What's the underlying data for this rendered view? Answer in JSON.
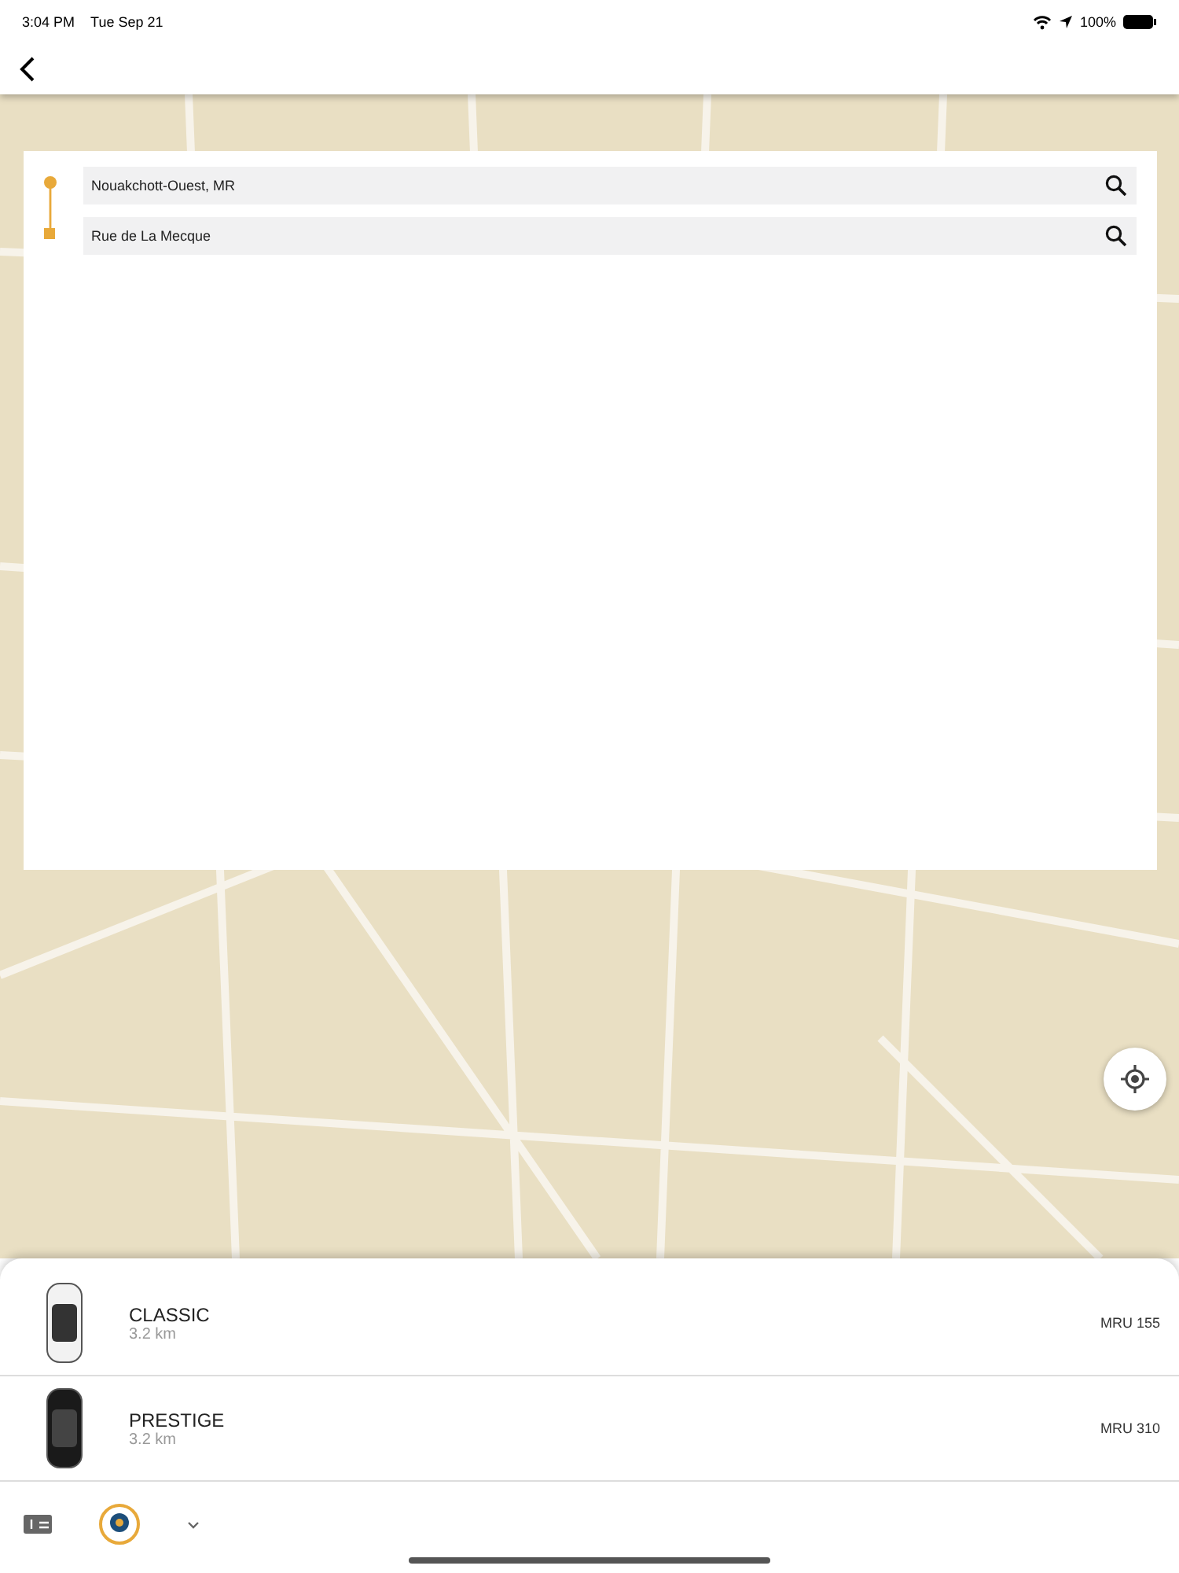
{
  "status_bar": {
    "time": "3:04 PM",
    "date": "Tue Sep 21",
    "battery": "100%"
  },
  "route": {
    "pickup": {
      "value": "Nouakchott-Ouest, MR"
    },
    "destination": {
      "value": "Rue de La Mecque"
    }
  },
  "rides": [
    {
      "name": "CLASSIC",
      "distance": "3.2 km",
      "price": "MRU 155",
      "kind": "white"
    },
    {
      "name": "PRESTIGE",
      "distance": "3.2 km",
      "price": "MRU 310",
      "kind": "black"
    }
  ]
}
